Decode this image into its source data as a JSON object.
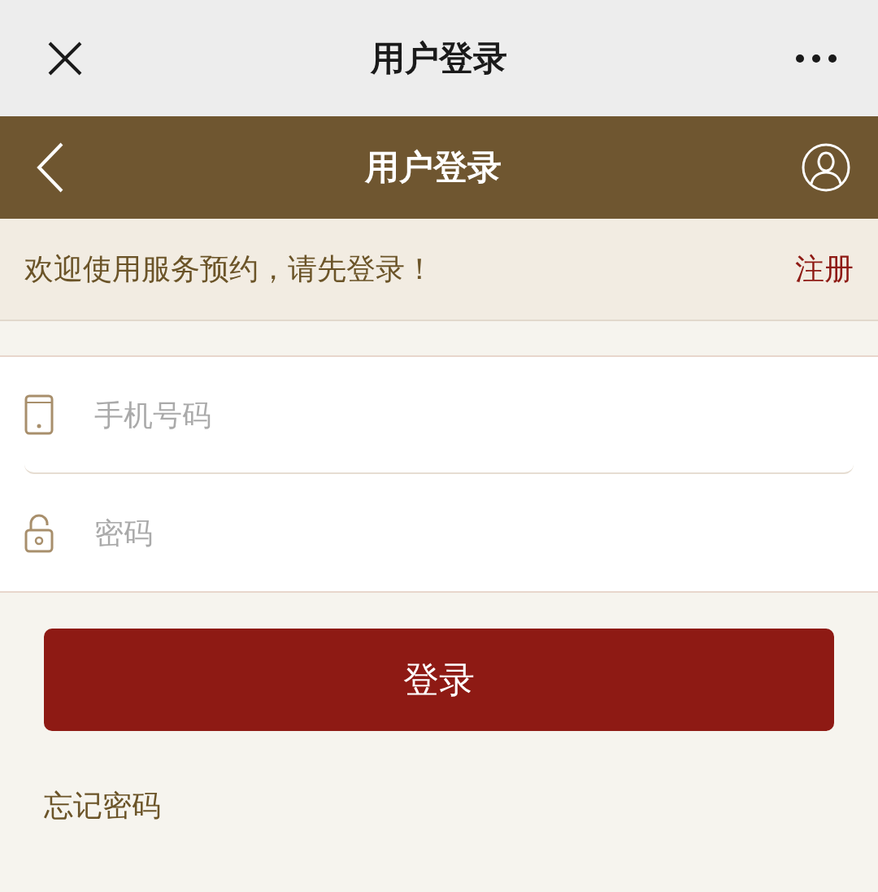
{
  "window": {
    "title": "用户登录"
  },
  "header": {
    "title": "用户登录"
  },
  "welcome": {
    "text": "欢迎使用服务预约，请先登录！",
    "register_link": "注册"
  },
  "fields": [
    {
      "kind": "phone",
      "placeholder": "手机号码"
    },
    {
      "kind": "password",
      "placeholder": "密码"
    }
  ],
  "login_button": "登录",
  "forgot_link": "忘记密码"
}
